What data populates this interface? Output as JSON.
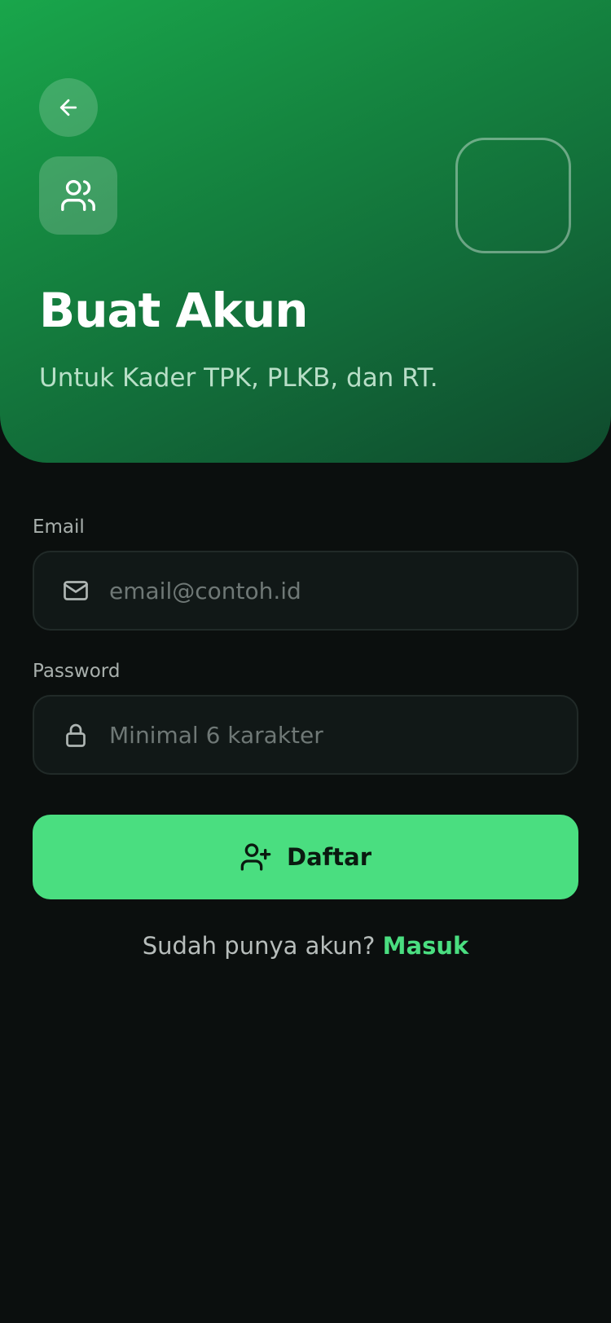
{
  "header": {
    "back_icon": "arrow-left-icon",
    "role_icon": "users-icon",
    "title": "Buat Akun",
    "subtitle": "Untuk Kader TPK, PLKB, dan RT."
  },
  "form": {
    "email": {
      "label": "Email",
      "placeholder": "email@contoh.id",
      "value": "",
      "icon": "mail-icon"
    },
    "password": {
      "label": "Password",
      "placeholder": "Minimal 6 karakter",
      "value": "",
      "icon": "lock-icon"
    },
    "submit": {
      "label": "Daftar",
      "icon": "user-plus-icon"
    }
  },
  "footer": {
    "prompt": "Sudah punya akun?",
    "link_label": "Masuk"
  },
  "colors": {
    "accent": "#4ade80",
    "hero_gradient_start": "#19a64b",
    "hero_gradient_end": "#0f4a2d",
    "background": "#0b0f0e"
  }
}
